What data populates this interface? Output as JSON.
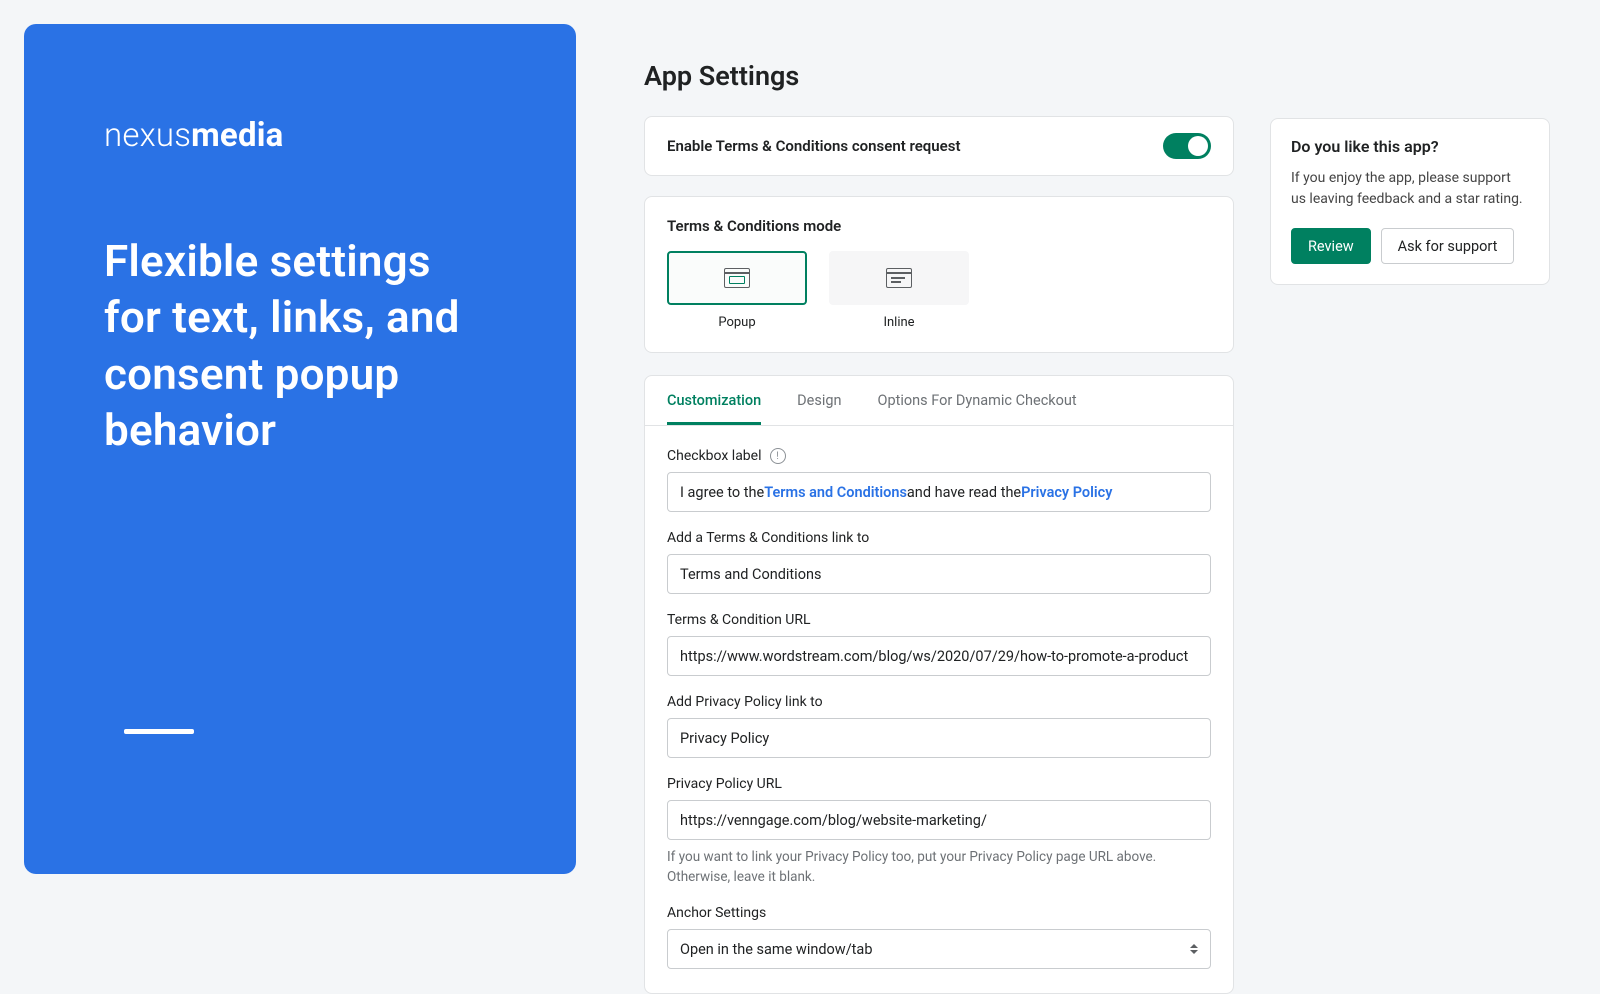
{
  "promo": {
    "brand_light": "nexus",
    "brand_bold": "media",
    "headline": "Flexible settings for text, links, and consent popup behavior"
  },
  "page_title": "App Settings",
  "enable": {
    "label": "Enable Terms & Conditions consent request",
    "on": true
  },
  "mode": {
    "title": "Terms & Conditions mode",
    "options": [
      {
        "label": "Popup",
        "selected": true
      },
      {
        "label": "Inline",
        "selected": false
      }
    ]
  },
  "tabs": [
    {
      "label": "Customization",
      "active": true
    },
    {
      "label": "Design",
      "active": false
    },
    {
      "label": "Options For Dynamic Checkout",
      "active": false
    }
  ],
  "form": {
    "checkbox_label": {
      "label": "Checkbox label",
      "segments": {
        "pre": "I agree to the ",
        "link1": "Terms and Conditions",
        "mid": " and have read the ",
        "link2": "Privacy Policy"
      }
    },
    "tc_linktext": {
      "label": "Add a Terms & Conditions link to",
      "value": "Terms and Conditions"
    },
    "tc_url": {
      "label": "Terms & Condition URL",
      "value": "https://www.wordstream.com/blog/ws/2020/07/29/how-to-promote-a-product"
    },
    "pp_linktext": {
      "label": "Add Privacy Policy link to",
      "value": "Privacy Policy"
    },
    "pp_url": {
      "label": "Privacy Policy URL",
      "value": "https://venngage.com/blog/website-marketing/",
      "helper": "If you want to link your Privacy Policy too, put your Privacy Policy page URL above. Otherwise, leave it blank."
    },
    "anchor": {
      "label": "Anchor Settings",
      "value": "Open in the same window/tab"
    }
  },
  "sidebar": {
    "title": "Do you like this app?",
    "text": "If you enjoy the app, please support us leaving feedback and a star rating.",
    "review_btn": "Review",
    "support_btn": "Ask for support"
  }
}
